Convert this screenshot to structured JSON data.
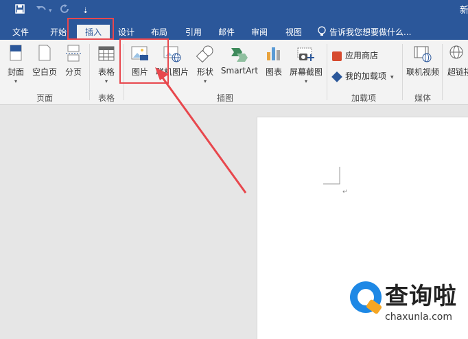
{
  "quick_access": {
    "save_icon": "save-icon",
    "undo_icon": "undo-icon",
    "redo_icon": "redo-icon",
    "customize": "⇣"
  },
  "title_fragment": "新",
  "tabs": [
    {
      "label": "文件"
    },
    {
      "label": "开始"
    },
    {
      "label": "插入"
    },
    {
      "label": "设计"
    },
    {
      "label": "布局"
    },
    {
      "label": "引用"
    },
    {
      "label": "邮件"
    },
    {
      "label": "审阅"
    },
    {
      "label": "视图"
    }
  ],
  "tell_me": "告诉我您想要做什么...",
  "ribbon": {
    "pages": {
      "cover": "封面",
      "blank": "空白页",
      "break": "分页",
      "group": "页面"
    },
    "tables": {
      "table": "表格",
      "group": "表格"
    },
    "illustrations": {
      "picture": "图片",
      "online_picture": "联机图片",
      "shapes": "形状",
      "smartart": "SmartArt",
      "chart": "图表",
      "screenshot": "屏幕截图",
      "group": "插图"
    },
    "addins": {
      "store": "应用商店",
      "my_addins": "我的加载项",
      "group": "加载项"
    },
    "media": {
      "online_video": "联机视频",
      "group": "媒体"
    },
    "links": {
      "hyperlink": "超链接"
    }
  },
  "document": {
    "return_mark": "↵"
  },
  "watermark": {
    "name": "查询啦",
    "url": "chaxunla.com"
  },
  "colors": {
    "accent": "#2b579a",
    "highlight": "#e8474d"
  }
}
